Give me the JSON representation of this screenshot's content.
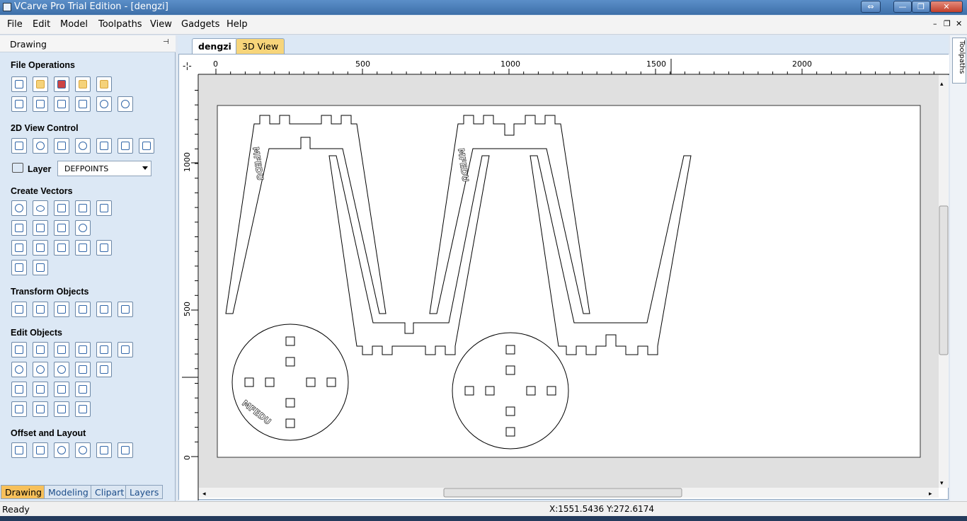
{
  "window": {
    "title": "VCarve Pro Trial Edition - [dengzi]",
    "controls": [
      "⇔",
      "—",
      "❐",
      "✕"
    ]
  },
  "menu": {
    "items": [
      "File",
      "Edit",
      "Model",
      "Toolpaths",
      "View",
      "Gadgets",
      "Help"
    ],
    "mdi": [
      "–",
      "❐",
      "✕"
    ]
  },
  "panel": {
    "title": "Drawing",
    "pin": "📌",
    "sections": {
      "file_ops": "File Operations",
      "view_ctrl": "2D View Control",
      "create": "Create Vectors",
      "transform": "Transform Objects",
      "edit": "Edit Objects",
      "offset": "Offset and Layout"
    },
    "layer_label": "Layer",
    "layer_value": "DEFPOINTS",
    "tabs": [
      "Drawing",
      "Modeling",
      "Clipart",
      "Layers"
    ]
  },
  "doc": {
    "tabs": [
      "dengzi",
      "3D View"
    ],
    "ruler_top": [
      "0",
      "500",
      "1000",
      "1500",
      "2000"
    ],
    "ruler_left": [
      "1000",
      "500",
      "0"
    ],
    "drawing": {
      "text_label": "MFEDU"
    }
  },
  "sidebar": {
    "tab": "Toolpaths"
  },
  "status": {
    "left": "Ready",
    "coords": "X:1551.5436 Y:272.6174"
  },
  "colors": {
    "title_bg": "#3d6fa8",
    "panel_bg": "#dce8f5",
    "active_tab": "#f7c05a"
  }
}
